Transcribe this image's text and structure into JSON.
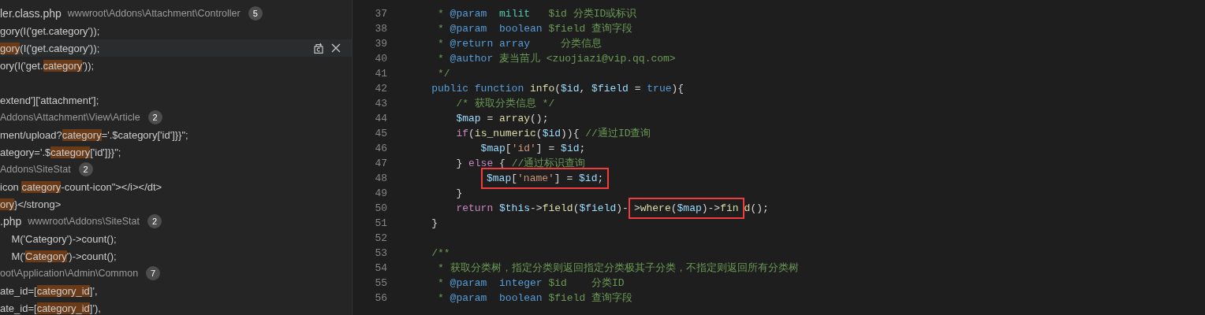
{
  "search_results": [
    {
      "kind": "file",
      "name": "ler.class.php",
      "path": "wwwroot\\Addons\\Attachment\\Controller",
      "count": "5"
    },
    {
      "kind": "match",
      "selected": false,
      "parts": [
        {
          "text": "gory(I('get.category'));",
          "highlight": false
        }
      ]
    },
    {
      "kind": "match",
      "selected": true,
      "parts": [
        {
          "text": "gory",
          "highlight": true
        },
        {
          "text": "(I('get.category'));",
          "highlight": false
        }
      ]
    },
    {
      "kind": "match",
      "selected": false,
      "parts": [
        {
          "text": "ory(I('get.",
          "highlight": false
        },
        {
          "text": "category",
          "highlight": true
        },
        {
          "text": "'));",
          "highlight": false
        }
      ]
    },
    {
      "kind": "blank"
    },
    {
      "kind": "match",
      "selected": false,
      "parts": [
        {
          "text": "extend']['attachment'];",
          "highlight": false
        }
      ]
    },
    {
      "kind": "file",
      "path": "Addons\\Attachment\\View\\Article",
      "count": "2"
    },
    {
      "kind": "match",
      "selected": false,
      "parts": [
        {
          "text": "ment/upload?",
          "highlight": false
        },
        {
          "text": "category",
          "highlight": true
        },
        {
          "text": "='.$category['id']}}\";",
          "highlight": false
        }
      ]
    },
    {
      "kind": "match",
      "selected": false,
      "parts": [
        {
          "text": "ategory='.$",
          "highlight": false
        },
        {
          "text": "category",
          "highlight": true
        },
        {
          "text": "['id']}}\";",
          "highlight": false
        }
      ]
    },
    {
      "kind": "file",
      "path": "Addons\\SiteStat",
      "count": "2"
    },
    {
      "kind": "match",
      "selected": false,
      "parts": [
        {
          "text": "icon ",
          "highlight": false
        },
        {
          "text": "category",
          "highlight": true
        },
        {
          "text": "-count-icon\"></i></dt>",
          "highlight": false
        }
      ]
    },
    {
      "kind": "match",
      "selected": false,
      "parts": [
        {
          "text": "ory",
          "highlight": true
        },
        {
          "text": "}</strong>",
          "highlight": false
        }
      ]
    },
    {
      "kind": "file",
      "name": ".php",
      "path": "wwwroot\\Addons\\SiteStat",
      "count": "2"
    },
    {
      "kind": "match",
      "selected": false,
      "parts": [
        {
          "text": "    M('Category')->count();",
          "highlight": false
        }
      ]
    },
    {
      "kind": "match",
      "selected": false,
      "parts": [
        {
          "text": "    M('",
          "highlight": false
        },
        {
          "text": "Category",
          "highlight": true
        },
        {
          "text": "')->count();",
          "highlight": false
        }
      ]
    },
    {
      "kind": "file",
      "path": "oot\\Application\\Admin\\Common",
      "count": "7"
    },
    {
      "kind": "match",
      "selected": false,
      "parts": [
        {
          "text": "ate_id=[",
          "highlight": false
        },
        {
          "text": "category_id",
          "highlight": true
        },
        {
          "text": "]',",
          "highlight": false
        }
      ]
    },
    {
      "kind": "match",
      "selected": false,
      "parts": [
        {
          "text": "ate_id=[",
          "highlight": false
        },
        {
          "text": "category_id",
          "highlight": true
        },
        {
          "text": "]'),",
          "highlight": false
        }
      ]
    }
  ],
  "editor": {
    "lines": [
      {
        "number": "37",
        "tokens": [
          {
            "kind": "comment",
            "text": "     * "
          },
          {
            "kind": "tag",
            "text": "@param  "
          },
          {
            "kind": "class",
            "text": "milit"
          },
          {
            "kind": "comment",
            "text": "   $id 分类ID或标识"
          }
        ]
      },
      {
        "number": "38",
        "tokens": [
          {
            "kind": "comment",
            "text": "     * "
          },
          {
            "kind": "tag",
            "text": "@param  "
          },
          {
            "kind": "type",
            "text": "boolean"
          },
          {
            "kind": "comment",
            "text": " $field 查询字段"
          }
        ]
      },
      {
        "number": "39",
        "tokens": [
          {
            "kind": "comment",
            "text": "     * "
          },
          {
            "kind": "tag",
            "text": "@return "
          },
          {
            "kind": "type",
            "text": "array"
          },
          {
            "kind": "comment",
            "text": "     分类信息"
          }
        ]
      },
      {
        "number": "40",
        "tokens": [
          {
            "kind": "comment",
            "text": "     * "
          },
          {
            "kind": "tag",
            "text": "@author"
          },
          {
            "kind": "comment",
            "text": " 麦当苗儿 <zuojiazi@vip.qq.com>"
          }
        ]
      },
      {
        "number": "41",
        "tokens": [
          {
            "kind": "comment",
            "text": "     */"
          }
        ]
      },
      {
        "number": "42",
        "tokens": [
          {
            "kind": "storage",
            "text": "    public function"
          },
          {
            "kind": "function",
            "text": " info"
          },
          {
            "kind": "punct",
            "text": "("
          },
          {
            "kind": "variable",
            "text": "$id"
          },
          {
            "kind": "punct",
            "text": ", "
          },
          {
            "kind": "variable",
            "text": "$field"
          },
          {
            "kind": "punct",
            "text": " = "
          },
          {
            "kind": "constant",
            "text": "true"
          },
          {
            "kind": "punct",
            "text": "){"
          }
        ]
      },
      {
        "number": "43",
        "tokens": [
          {
            "kind": "comment",
            "text": "        /* 获取分类信息 */"
          }
        ]
      },
      {
        "number": "44",
        "tokens": [
          {
            "kind": "variable",
            "text": "        $map"
          },
          {
            "kind": "punct",
            "text": " = "
          },
          {
            "kind": "function",
            "text": "array"
          },
          {
            "kind": "punct",
            "text": "();"
          }
        ]
      },
      {
        "number": "45",
        "tokens": [
          {
            "kind": "keyword",
            "text": "        if"
          },
          {
            "kind": "punct",
            "text": "("
          },
          {
            "kind": "function",
            "text": "is_numeric"
          },
          {
            "kind": "punct",
            "text": "("
          },
          {
            "kind": "variable",
            "text": "$id"
          },
          {
            "kind": "punct",
            "text": ")){ "
          },
          {
            "kind": "comment",
            "text": "//通过ID查询"
          }
        ]
      },
      {
        "number": "46",
        "tokens": [
          {
            "kind": "variable",
            "text": "            $map"
          },
          {
            "kind": "punct",
            "text": "["
          },
          {
            "kind": "string",
            "text": "'id'"
          },
          {
            "kind": "punct",
            "text": "] = "
          },
          {
            "kind": "variable",
            "text": "$id"
          },
          {
            "kind": "punct",
            "text": ";"
          }
        ]
      },
      {
        "number": "47",
        "tokens": [
          {
            "kind": "punct",
            "text": "        } "
          },
          {
            "kind": "keyword",
            "text": "else"
          },
          {
            "kind": "punct",
            "text": " { "
          },
          {
            "kind": "comment",
            "text": "//通过标识查询"
          }
        ]
      },
      {
        "number": "48",
        "tokens": [
          {
            "kind": "box",
            "tokens": [
              {
                "kind": "variable",
                "text": "$map"
              },
              {
                "kind": "punct",
                "text": "["
              },
              {
                "kind": "string",
                "text": "'name'"
              },
              {
                "kind": "punct",
                "text": "] = "
              },
              {
                "kind": "variable",
                "text": "$id"
              },
              {
                "kind": "punct",
                "text": ";"
              }
            ]
          }
        ]
      },
      {
        "number": "49",
        "tokens": [
          {
            "kind": "punct",
            "text": "        }"
          }
        ]
      },
      {
        "number": "50",
        "tokens": [
          {
            "kind": "keyword",
            "text": "        return"
          },
          {
            "kind": "variable",
            "text": " $this"
          },
          {
            "kind": "punct",
            "text": "->"
          },
          {
            "kind": "function",
            "text": "field"
          },
          {
            "kind": "punct",
            "text": "("
          },
          {
            "kind": "variable",
            "text": "$field"
          },
          {
            "kind": "punct",
            "text": ")-"
          },
          {
            "kind": "box",
            "tokens": [
              {
                "kind": "punct",
                "text": ">"
              },
              {
                "kind": "function",
                "text": "where"
              },
              {
                "kind": "punct",
                "text": "("
              },
              {
                "kind": "variable",
                "text": "$map"
              },
              {
                "kind": "punct",
                "text": ")->"
              },
              {
                "kind": "function",
                "text": "fin"
              }
            ]
          },
          {
            "kind": "function",
            "text": "d"
          },
          {
            "kind": "punct",
            "text": "();"
          }
        ]
      },
      {
        "number": "51",
        "tokens": [
          {
            "kind": "punct",
            "text": "    }"
          }
        ]
      },
      {
        "number": "52"
      },
      {
        "number": "53",
        "tokens": [
          {
            "kind": "comment",
            "text": "    /**"
          }
        ]
      },
      {
        "number": "54",
        "tokens": [
          {
            "kind": "comment",
            "text": "     * 获取分类树，指定分类则返回指定分类极其子分类，不指定则返回所有分类树"
          }
        ]
      },
      {
        "number": "55",
        "tokens": [
          {
            "kind": "comment",
            "text": "     * "
          },
          {
            "kind": "tag",
            "text": "@param  "
          },
          {
            "kind": "type",
            "text": "integer"
          },
          {
            "kind": "comment",
            "text": " $id    分类ID"
          }
        ]
      },
      {
        "number": "56",
        "tokens": [
          {
            "kind": "comment",
            "text": "     * "
          },
          {
            "kind": "tag",
            "text": "@param  "
          },
          {
            "kind": "type",
            "text": "boolean"
          },
          {
            "kind": "comment",
            "text": " $field 查询字段"
          }
        ]
      }
    ]
  }
}
